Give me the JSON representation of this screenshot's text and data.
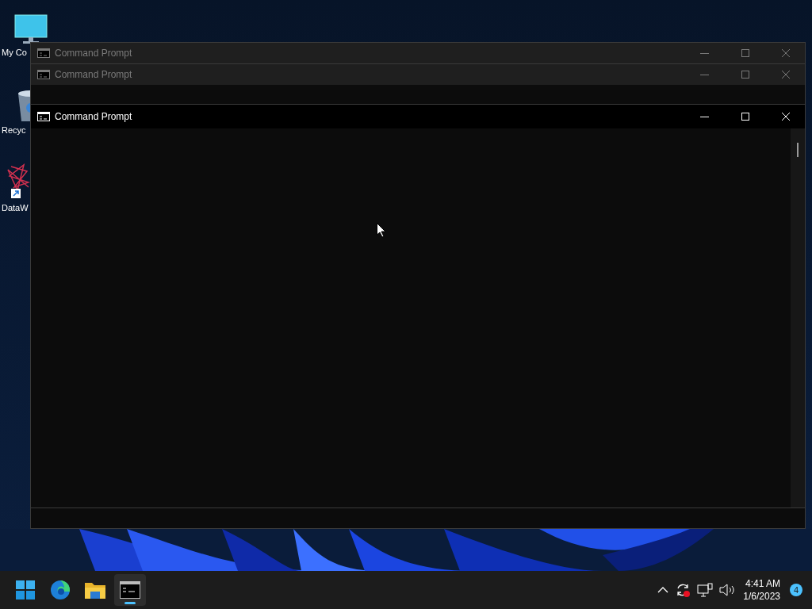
{
  "desktop_icons": [
    {
      "kind": "computer",
      "label": "My Co"
    },
    {
      "kind": "recycle",
      "label": "Recyc"
    },
    {
      "kind": "app",
      "label": "DataW"
    }
  ],
  "windows": [
    {
      "title": "Command Prompt",
      "active": false
    },
    {
      "title": "Command Prompt",
      "active": false
    },
    {
      "title": "Command Prompt",
      "active": true
    }
  ],
  "taskbar": {
    "apps": [
      {
        "kind": "start",
        "selected": false
      },
      {
        "kind": "edge",
        "selected": false
      },
      {
        "kind": "folder",
        "selected": false
      },
      {
        "kind": "terminal",
        "selected": true
      }
    ],
    "time": "4:41 AM",
    "date": "1/6/2023",
    "notifications": "4"
  }
}
